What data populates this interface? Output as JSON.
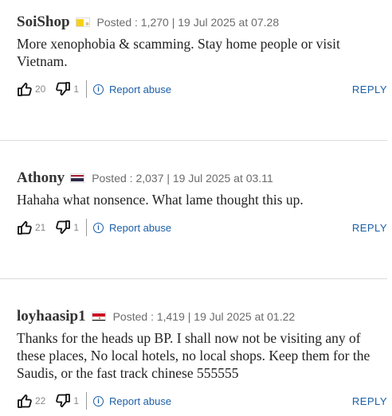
{
  "colors": {
    "link": "#1b5fa8",
    "username": "#333333",
    "meta": "#6b6b6b",
    "divider": "#dcdcdc"
  },
  "comments": [
    {
      "username": "SoiShop",
      "flag": "vatican-flag",
      "meta": "Posted : 1,270 | 19 Jul 2025 at 07.28",
      "body": "More xenophobia & scamming. Stay home people or visit Vietnam.",
      "upvotes": "20",
      "downvotes": "1",
      "report_label": "Report abuse",
      "reply_label": "REPLY"
    },
    {
      "username": "Athony",
      "flag": "thailand-flag",
      "meta": "Posted : 2,037 | 19 Jul 2025 at 03.11",
      "body": "Hahaha what nonsence. What lame thought this up.",
      "upvotes": "21",
      "downvotes": "1",
      "report_label": "Report abuse",
      "reply_label": "REPLY"
    },
    {
      "username": "loyhaasip1",
      "flag": "egypt-flag",
      "meta": "Posted : 1,419 | 19 Jul 2025 at 01.22",
      "body": "Thanks for the heads up BP. I shall now not be visiting any of these places, No local hotels, no local shops. Keep them for the Saudis, or the fast track chinese 555555",
      "upvotes": "22",
      "downvotes": "1",
      "report_label": "Report abuse",
      "reply_label": "REPLY"
    }
  ]
}
